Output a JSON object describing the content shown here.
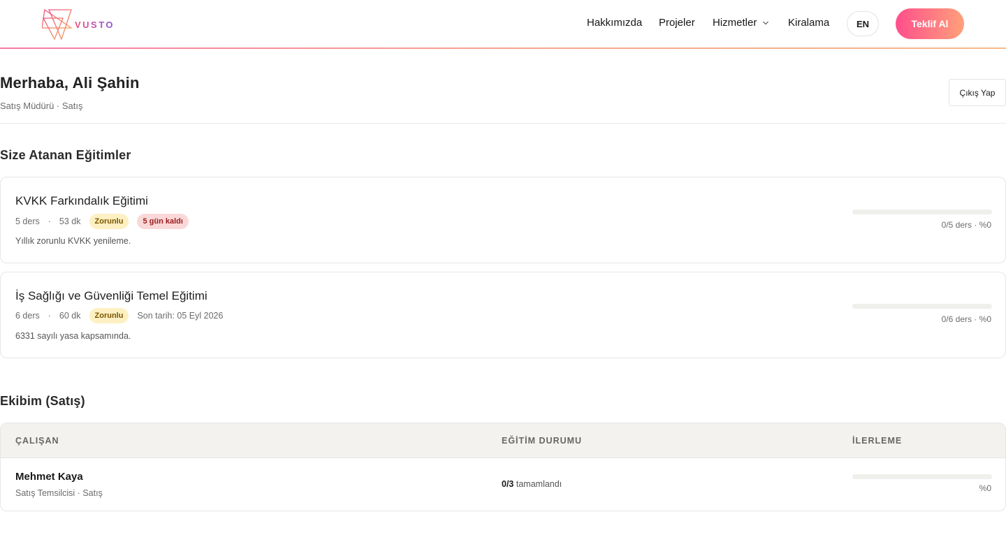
{
  "brand": {
    "name": "VUSTO",
    "logo": "vusto-triangle-logo"
  },
  "nav": {
    "items": [
      {
        "label": "Hakkımızda"
      },
      {
        "label": "Projeler"
      },
      {
        "label": "Hizmetler",
        "icon": "chevron-down-icon"
      },
      {
        "label": "Kiralama"
      }
    ],
    "lang_label": "EN",
    "cta_label": "Teklif Al"
  },
  "user": {
    "greeting": "Merhaba, Ali Şahin",
    "subtitle": "Satış Müdürü · Satış",
    "logout_label": "Çıkış Yap"
  },
  "trainings": {
    "title": "Size Atanan Eğitimler",
    "items": [
      {
        "name": "KVKK Farkındalık Eğitimi",
        "lessons": "5 ders",
        "duration": "53 dk",
        "required": "Zorunlu",
        "due_badge": "5 gün kaldı",
        "description": "Yıllık zorunlu KVKK yenileme.",
        "progress_text": "0/5 ders · %0",
        "progress": 0
      },
      {
        "name": "İş Sağlığı ve Güvenliği Temel Eğitimi",
        "lessons": "6 ders",
        "duration": "60 dk",
        "required": "Zorunlu",
        "deadline": "Son tarih: 05 Eyl 2026",
        "description": "6331 sayılı yasa kapsamında.",
        "progress_text": "0/6 ders · %0",
        "progress": 0
      }
    ]
  },
  "team": {
    "title": "Ekibim (Satış)",
    "columns": [
      "ÇALIŞAN",
      "EĞİTİM DURUMU",
      "İLERLEME"
    ],
    "rows": [
      {
        "name": "Mehmet Kaya",
        "role": "Satış Temsilcisi · Satış",
        "status_count": "0/3",
        "status_label": "tamamlandı",
        "progress_text": "%0",
        "progress": 0
      }
    ]
  },
  "colors": {
    "accent_start": "#ff4f8b",
    "accent_end": "#ffa07a",
    "badge_required_bg": "#fdf0c2",
    "badge_due_bg": "#fbd8d8"
  }
}
